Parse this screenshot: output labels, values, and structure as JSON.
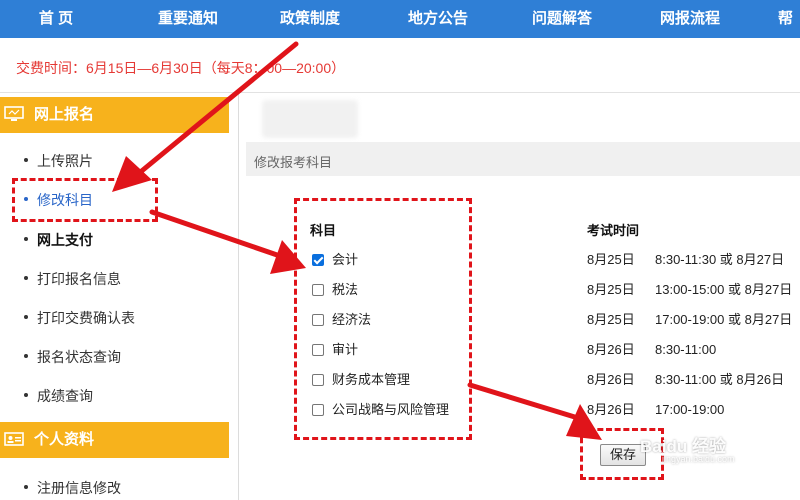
{
  "nav": {
    "items": [
      "首 页",
      "重要通知",
      "政策制度",
      "地方公告",
      "问题解答",
      "网报流程",
      "帮"
    ]
  },
  "notice": "交费时间：6月15日—6月30日（每天8：00—20:00）",
  "sidebar": {
    "section1": {
      "title": "网上报名",
      "icon": "monitor-icon"
    },
    "items": [
      "上传照片",
      "修改科目",
      "网上支付",
      "打印报名信息",
      "打印交费确认表",
      "报名状态查询",
      "成绩查询"
    ],
    "section2": {
      "title": "个人资料",
      "icon": "id-card-icon"
    },
    "items2": [
      "注册信息修改"
    ]
  },
  "main": {
    "section_title": "修改报考科目",
    "col_subject": "科目",
    "col_time": "考试时间",
    "subjects": [
      {
        "name": "会计",
        "checked": true,
        "date": "8月25日",
        "time": "8:30-11:30 或 8月27日"
      },
      {
        "name": "税法",
        "checked": false,
        "date": "8月25日",
        "time": "13:00-15:00 或 8月27日"
      },
      {
        "name": "经济法",
        "checked": false,
        "date": "8月25日",
        "time": "17:00-19:00 或 8月27日"
      },
      {
        "name": "审计",
        "checked": false,
        "date": "8月26日",
        "time": "8:30-11:00"
      },
      {
        "name": "财务成本管理",
        "checked": false,
        "date": "8月26日",
        "time": "8:30-11:00 或 8月26日"
      },
      {
        "name": "公司战略与风险管理",
        "checked": false,
        "date": "8月26日",
        "time": "17:00-19:00"
      }
    ],
    "save_label": "保存"
  },
  "watermark": {
    "text": "Baidu 经验",
    "sub": "jingyan.baidu.com"
  },
  "colors": {
    "nav_bg": "#2f7fd6",
    "side_head": "#f7b21c",
    "notice": "#e53935",
    "annotation": "#e0141a"
  }
}
